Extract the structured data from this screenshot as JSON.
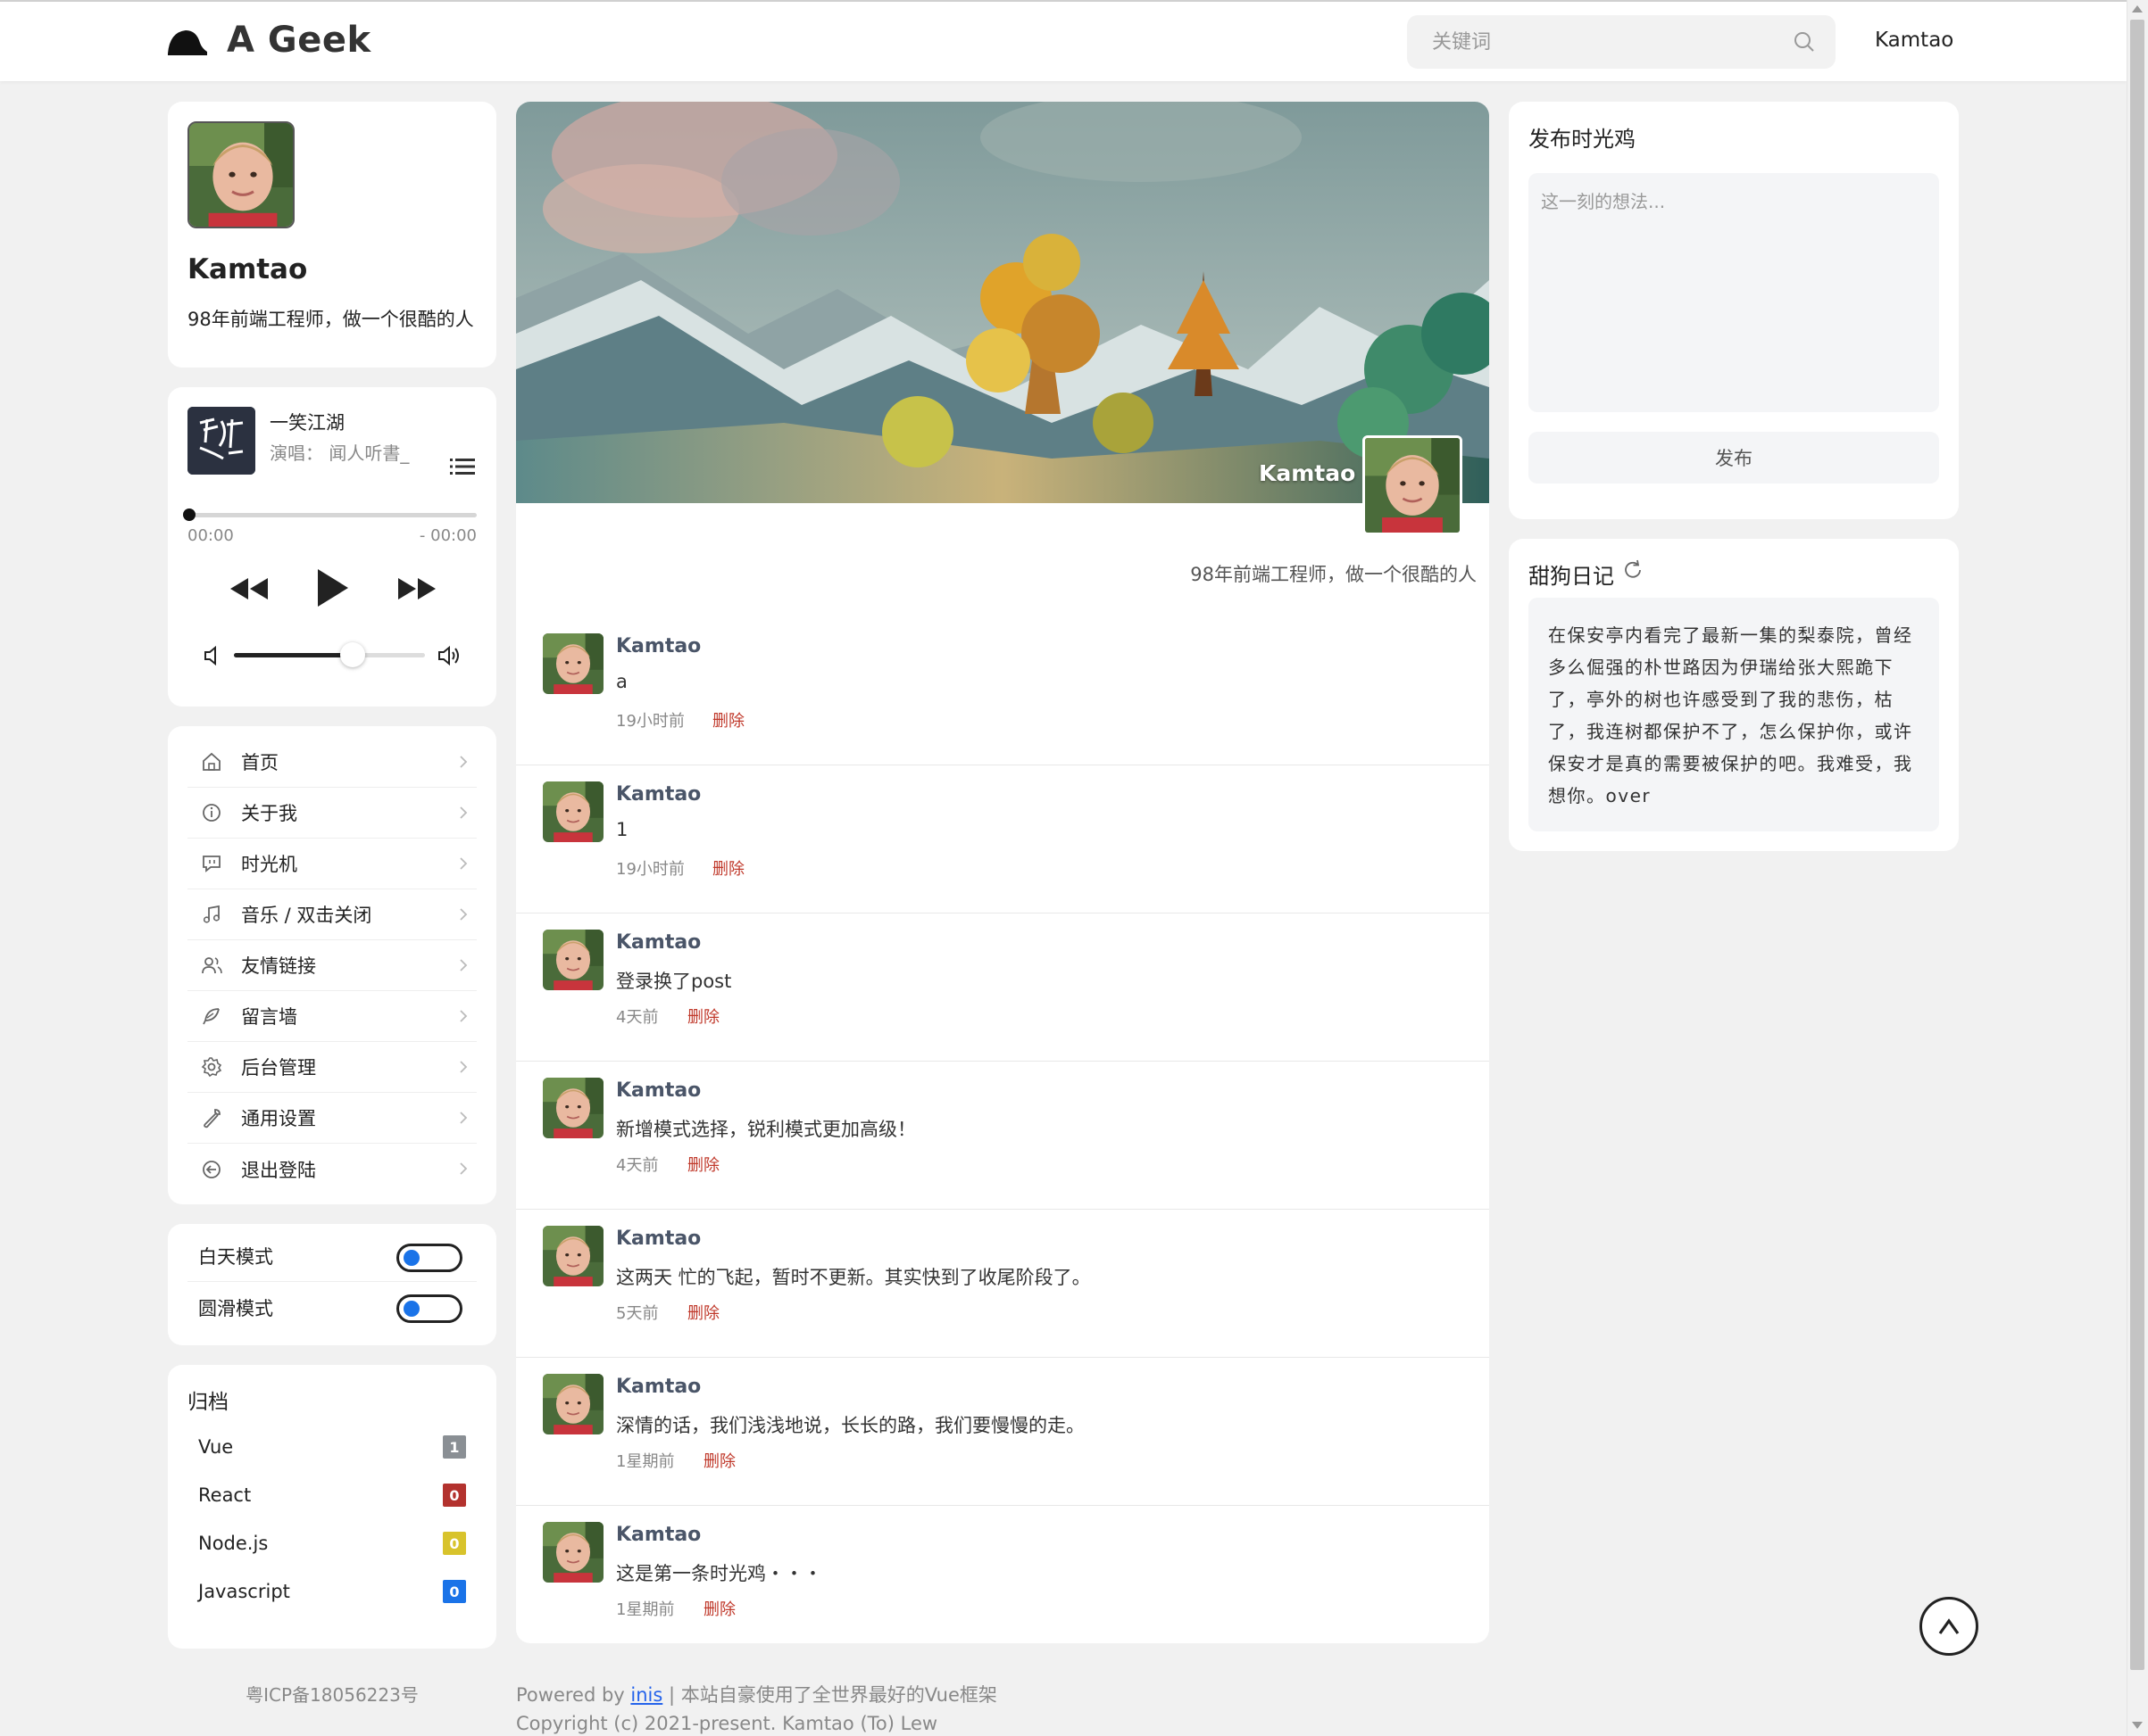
{
  "header": {
    "site_title": "A Geek",
    "search_placeholder": "关键词",
    "user_name": "Kamtao"
  },
  "profile": {
    "name": "Kamtao",
    "bio": "98年前端工程师，做一个很酷的人"
  },
  "music": {
    "title": "一笑江湖",
    "artist": "演唱：  闻人听書_",
    "time_current": "00:00",
    "time_remaining": "- 00:00",
    "progress": 0,
    "volume": 0.62
  },
  "nav": {
    "items": [
      {
        "label": "首页",
        "icon": "home-icon"
      },
      {
        "label": "关于我",
        "icon": "info-icon"
      },
      {
        "label": "时光机",
        "icon": "chat-bubble-icon"
      },
      {
        "label": "音乐 / 双击关闭",
        "icon": "music-note-icon"
      },
      {
        "label": "友情链接",
        "icon": "users-icon"
      },
      {
        "label": "留言墙",
        "icon": "feather-icon"
      },
      {
        "label": "后台管理",
        "icon": "gear-icon"
      },
      {
        "label": "通用设置",
        "icon": "wrench-icon"
      },
      {
        "label": "退出登陆",
        "icon": "logout-icon"
      }
    ]
  },
  "modes": {
    "day_mode_label": "白天模式",
    "smooth_mode_label": "圆滑模式"
  },
  "archive": {
    "title": "归档",
    "items": [
      {
        "label": "Vue",
        "count": "1",
        "color": "#8a8f94"
      },
      {
        "label": "React",
        "count": "0",
        "color": "#b3322e"
      },
      {
        "label": "Node.js",
        "count": "0",
        "color": "#d8c32c"
      },
      {
        "label": "Javascript",
        "count": "0",
        "color": "#1a73e8"
      }
    ]
  },
  "icp": "粤ICP备18056223号",
  "main": {
    "banner_name": "Kamtao",
    "bio": "98年前端工程师，做一个很酷的人",
    "posts": [
      {
        "author": "Kamtao",
        "content": "a",
        "time": "19小时前",
        "delete_label": "删除"
      },
      {
        "author": "Kamtao",
        "content": "1",
        "time": "19小时前",
        "delete_label": "删除"
      },
      {
        "author": "Kamtao",
        "content": "登录换了post",
        "time": "4天前",
        "delete_label": "删除"
      },
      {
        "author": "Kamtao",
        "content": "新增模式选择，锐利模式更加高级！",
        "time": "4天前",
        "delete_label": "删除"
      },
      {
        "author": "Kamtao",
        "content": "这两天 忙的飞起，暂时不更新。其实快到了收尾阶段了。",
        "time": "5天前",
        "delete_label": "删除"
      },
      {
        "author": "Kamtao",
        "content": "深情的话，我们浅浅地说，长长的路，我们要慢慢的走。",
        "time": "1星期前",
        "delete_label": "删除"
      },
      {
        "author": "Kamtao",
        "content": "这是第一条时光鸡・・・",
        "time": "1星期前",
        "delete_label": "删除"
      }
    ]
  },
  "footer": {
    "powered_prefix": "Powered by ",
    "powered_link": "inis",
    "powered_suffix": " | 本站自豪使用了全世界最好的Vue框架",
    "copyright": "Copyright (c) 2021-present. Kamtao (To) Lew"
  },
  "publish": {
    "title": "发布时光鸡",
    "placeholder": "这一刻的想法...",
    "button_label": "发布"
  },
  "diary": {
    "title": "甜狗日记",
    "text": "在保安亭内看完了最新一集的梨泰院，曾经多么倔强的朴世路因为伊瑞给张大熙跪下了，亭外的树也许感受到了我的悲伤，枯了，我连树都保护不了，怎么保护你，或许保安才是真的需要被保护的吧。我难受，我想你。over"
  },
  "back_to_top_label": "^"
}
